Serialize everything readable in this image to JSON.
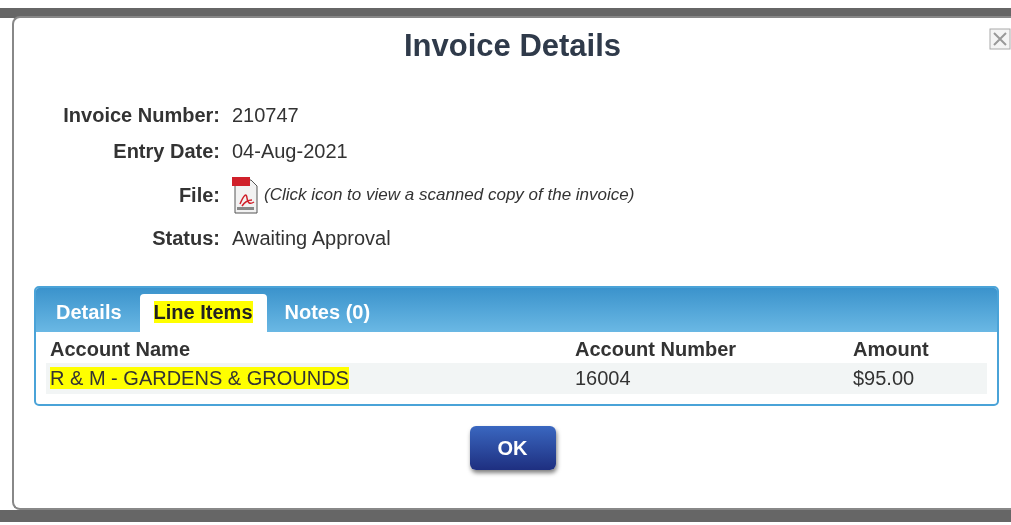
{
  "dialog": {
    "title": "Invoice Details"
  },
  "fields": [
    {
      "label": "Invoice Number:",
      "value": "210747",
      "kind": "text"
    },
    {
      "label": "Entry Date:",
      "value": "04-Aug-2021",
      "kind": "text"
    },
    {
      "label": "File:",
      "value": "(Click icon to view a scanned copy of the invoice)",
      "kind": "file"
    },
    {
      "label": "Status:",
      "value": "Awaiting Approval",
      "kind": "text"
    }
  ],
  "tabs": [
    {
      "label": "Details",
      "selected": false,
      "highlighted": false
    },
    {
      "label": "Line Items",
      "selected": true,
      "highlighted": true
    },
    {
      "label": "Notes (0)",
      "selected": false,
      "highlighted": false
    }
  ],
  "table": {
    "columns": [
      "Account Name",
      "Account Number",
      "Amount"
    ],
    "rows": [
      {
        "cells": [
          {
            "text": "R & M - GARDENS & GROUNDS",
            "highlighted": true
          },
          {
            "text": "16004",
            "highlighted": false
          },
          {
            "text": "$95.00",
            "highlighted": false
          }
        ]
      }
    ]
  },
  "buttons": [
    "OK"
  ]
}
